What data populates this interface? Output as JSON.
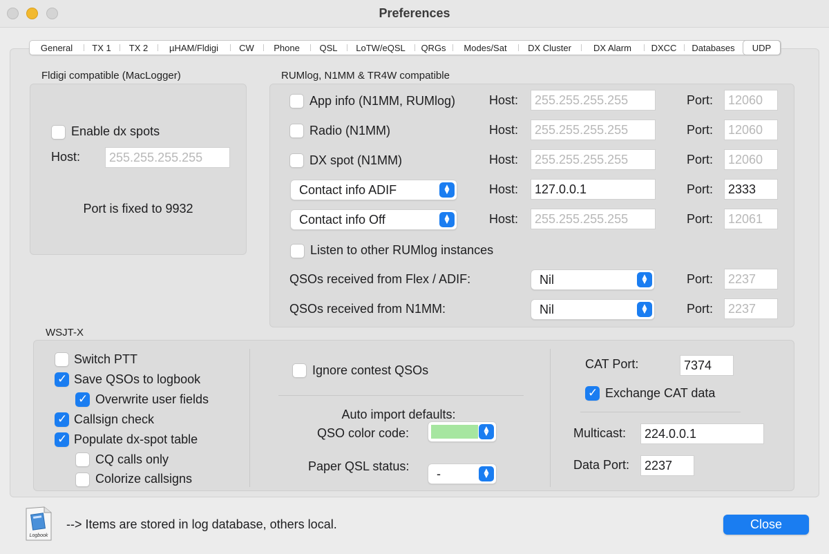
{
  "window": {
    "title": "Preferences"
  },
  "tabs": [
    {
      "label": "General"
    },
    {
      "label": "TX 1"
    },
    {
      "label": "TX 2"
    },
    {
      "label": "µHAM/Fldigi"
    },
    {
      "label": "CW"
    },
    {
      "label": "Phone"
    },
    {
      "label": "QSL"
    },
    {
      "label": "LoTW/eQSL"
    },
    {
      "label": "QRGs"
    },
    {
      "label": "Modes/Sat"
    },
    {
      "label": "DX Cluster"
    },
    {
      "label": "DX Alarm"
    },
    {
      "label": "DXCC"
    },
    {
      "label": "Databases"
    },
    {
      "label": "UDP",
      "active": true
    }
  ],
  "fldigi": {
    "title": "Fldigi compatible (MacLogger)",
    "enable_label": "Enable dx spots",
    "enable_checked": false,
    "host_label": "Host:",
    "host_value": "255.255.255.255",
    "note": "Port is fixed to 9932"
  },
  "rumlog": {
    "title": "RUMlog, N1MM & TR4W compatible",
    "host_label": "Host:",
    "port_label": "Port:",
    "rows": [
      {
        "label": "App info (N1MM, RUMlog)",
        "checked": false,
        "host": "255.255.255.255",
        "port": "12060"
      },
      {
        "label": "Radio (N1MM)",
        "checked": false,
        "host": "255.255.255.255",
        "port": "12060"
      },
      {
        "label": "DX spot (N1MM)",
        "checked": false,
        "host": "255.255.255.255",
        "port": "12060"
      }
    ],
    "popup_rows": [
      {
        "selected": "Contact info ADIF",
        "host": "127.0.0.1",
        "port": "2333"
      },
      {
        "selected": "Contact info Off",
        "host": "255.255.255.255",
        "port": "12061"
      }
    ],
    "listen_label": "Listen to other RUMlog instances",
    "listen_checked": false,
    "received": [
      {
        "label": "QSOs received from Flex / ADIF:",
        "selected": "Nil",
        "port": "2237"
      },
      {
        "label": "QSOs received from N1MM:",
        "selected": "Nil",
        "port": "2237"
      }
    ]
  },
  "wsjtx": {
    "title": "WSJT-X",
    "switch_ptt": {
      "label": "Switch PTT",
      "checked": false
    },
    "save_qsos": {
      "label": "Save QSOs to logbook",
      "checked": true
    },
    "overwrite": {
      "label": "Overwrite user fields",
      "checked": true
    },
    "callsign_check": {
      "label": "Callsign check",
      "checked": true
    },
    "populate": {
      "label": "Populate dx-spot table",
      "checked": true
    },
    "cq_only": {
      "label": "CQ calls only",
      "checked": false
    },
    "colorize": {
      "label": "Colorize callsigns",
      "checked": false
    },
    "ignore_contest": {
      "label": "Ignore contest QSOs",
      "checked": false
    },
    "auto_import_label": "Auto import defaults:",
    "qso_color_label": "QSO color code:",
    "qso_color_value": "#a6e6a0",
    "paper_qsl_label": "Paper QSL status:",
    "paper_qsl_value": "-",
    "cat_port_label": "CAT Port:",
    "cat_port_value": "7374",
    "exchange_cat": {
      "label": "Exchange CAT data",
      "checked": true
    },
    "multicast_label": "Multicast:",
    "multicast_value": "224.0.0.1",
    "data_port_label": "Data Port:",
    "data_port_value": "2237"
  },
  "footer": {
    "icon_caption": "Logbook",
    "note": "--> Items are stored in log database, others local.",
    "close_label": "Close"
  },
  "colors": {
    "accent": "#1a7df1",
    "background": "#ececec"
  }
}
